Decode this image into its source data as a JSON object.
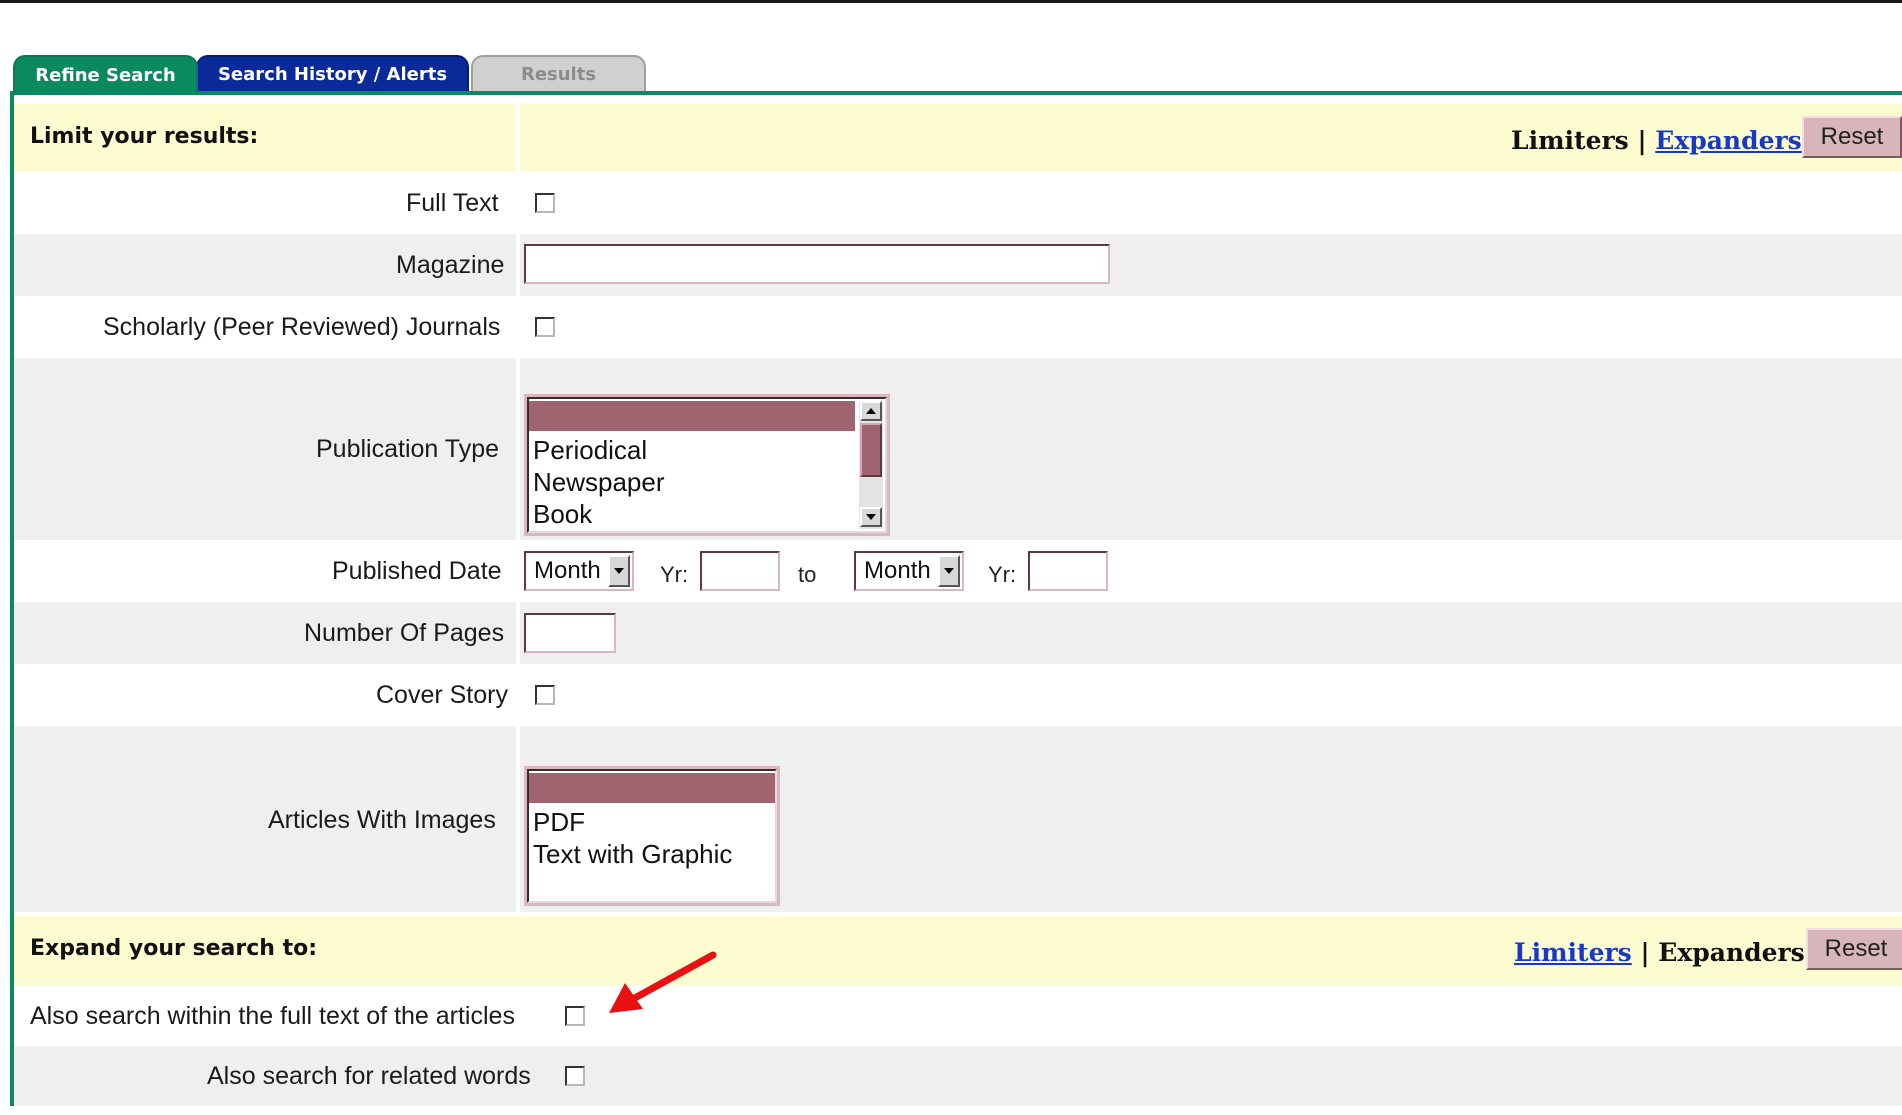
{
  "tabs": {
    "refine": "Refine Search",
    "history": "Search History / Alerts",
    "results": "Results"
  },
  "limiters": {
    "title": "Limit your results:",
    "nav_current": "Limiters",
    "nav_sep": "|",
    "nav_link": "Expanders",
    "reset": "Reset",
    "full_text": "Full Text",
    "magazine": "Magazine",
    "magazine_value": "",
    "scholarly": "Scholarly (Peer Reviewed) Journals",
    "publication_type": "Publication Type",
    "publication_options": [
      "Periodical",
      "Newspaper",
      "Book"
    ],
    "published_date": "Published Date",
    "month_1": "Month",
    "yr_label_1": "Yr:",
    "to": "to",
    "month_2": "Month",
    "yr_label_2": "Yr:",
    "number_of_pages": "Number Of Pages",
    "cover_story": "Cover Story",
    "articles_with_images": "Articles With Images",
    "image_options": [
      "PDF",
      "Text with Graphic"
    ]
  },
  "expanders": {
    "title": "Expand your search to:",
    "nav_link": "Limiters",
    "nav_sep": "|",
    "nav_current": "Expanders",
    "reset": "Reset",
    "full_text_within": "Also search within the full text of the articles",
    "related_words": "Also search for related words"
  },
  "colors": {
    "tab_refine": "#0a8a5e",
    "tab_history": "#0a2a9a",
    "tab_results": "#d0d0d0",
    "highlight": "#a06470",
    "section_bg": "#fdfcd0",
    "annotation_arrow": "#e81010"
  }
}
